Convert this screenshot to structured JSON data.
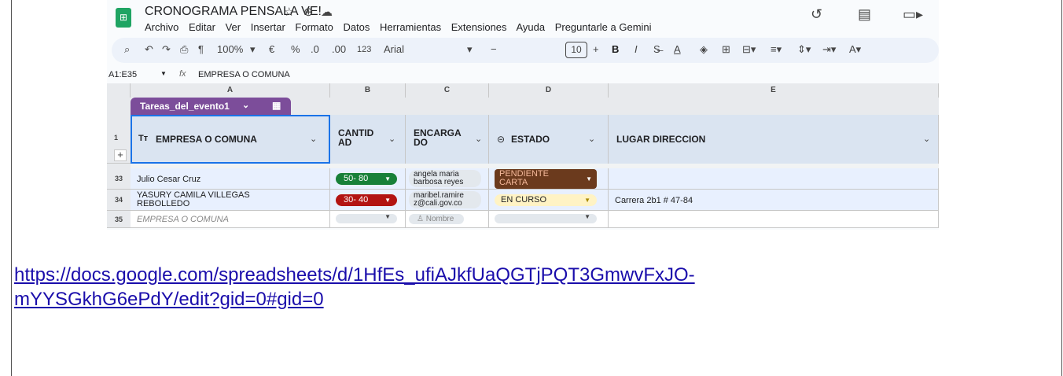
{
  "window": {
    "title": "CRONOGRAMA PENSALA VE!"
  },
  "menu": [
    "Archivo",
    "Editar",
    "Ver",
    "Insertar",
    "Formato",
    "Datos",
    "Herramientas",
    "Extensiones",
    "Ayuda",
    "Preguntarle a Gemini"
  ],
  "toolbar": {
    "zoom": "100%",
    "currency": "€",
    "percent": "%",
    "dec_decrease": ".0",
    "dec_increase": ".00",
    "number_format": "123",
    "font": "Arial",
    "font_size": "10",
    "bold": "B",
    "italic": "I"
  },
  "formula_bar": {
    "name_box": "A1:E35",
    "fx": "fx",
    "value": "EMPRESA O COMUNA"
  },
  "columns": [
    "A",
    "B",
    "C",
    "D",
    "E"
  ],
  "table": {
    "name": "Tareas_del_evento1",
    "header_row_number": "1",
    "headers": {
      "a": "EMPRESA O COMUNA",
      "b1": "CANTID",
      "b2": "AD",
      "c1": "ENCARGA",
      "c2": "DO",
      "d": "ESTADO",
      "e": "LUGAR DIRECCION"
    },
    "header_type_icon": "Tт",
    "rows": [
      {
        "num": "33",
        "empresa": "Julio Cesar Cruz",
        "cantidad": "50- 80",
        "cantidad_color": "#188038",
        "encargado1": "angela maria",
        "encargado2": "barbosa reyes",
        "estado1": "PENDIENTE",
        "estado2": "CARTA",
        "lugar": ""
      },
      {
        "num": "34",
        "empresa1": "YASURY CAMILA VILLEGAS",
        "empresa2": "REBOLLEDO",
        "cantidad": "30- 40",
        "cantidad_color": "#b31412",
        "encargado1": "maribel.ramire",
        "encargado2": "z@cali.gov.co",
        "estado": "EN CURSO",
        "lugar": "Carrera 2b1 # 47-84"
      },
      {
        "num": "35",
        "empresa_placeholder": "EMPRESA O COMUNA",
        "encargado_placeholder": "Nombre"
      }
    ]
  },
  "link": {
    "line1": "https://docs.google.com/spreadsheets/d/1HfEs_ufiAJkfUaQGTjPQT3GmwvFxJO-",
    "line2": "mYYSGkhG6ePdY/edit?gid=0#gid=0"
  }
}
